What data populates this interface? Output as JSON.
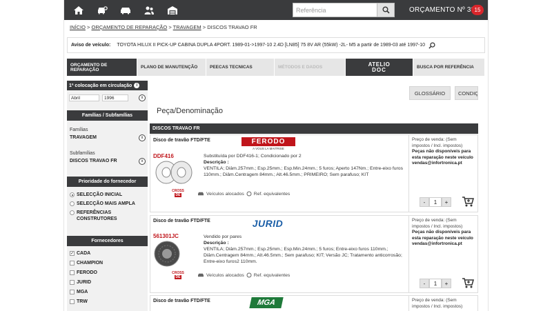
{
  "header": {
    "search_placeholder": "Referência",
    "orcamento_label": "ORÇAMENTO Nº",
    "orcamento_num": "38",
    "badge": "15",
    "nav_icons": [
      "home-icon",
      "car-search-icon",
      "car-icon",
      "users-icon",
      "garage-icon"
    ]
  },
  "breadcrumb": {
    "items": [
      "INÍCIO",
      "ORÇAMENTO DE REPARAÇÃO",
      "TRAVAGEM",
      "DISCOS TRAVAO FR"
    ],
    "sep": " > "
  },
  "vehicle": {
    "label": "Aviso de veículo:",
    "value": "TOYOTA HILUX II PICK-UP CABINA DUPLA 4PORT. 1989-01->1997-10 2.4D [LN85] 75 8V AR (55kW) -2L- M5 a partir de 1989-03 até 1997-10"
  },
  "tabs": [
    {
      "label": "ORÇAMENTO DE REPARAÇÃO"
    },
    {
      "label": "PLANO DE MANUTENÇÃO"
    },
    {
      "label": "PEECAS TECNICAS"
    },
    {
      "label": "MÉTODOS E DADOS"
    },
    {
      "label": "ATELIO"
    },
    {
      "label": "BUSCA POR REFERÊNCIA"
    }
  ],
  "atelio_sub": "DOC",
  "sidebar": {
    "circulation_title": "1ª colocação em circulação",
    "month": "Abril",
    "year": "1996",
    "families_title": "Famílias / Subfamílias",
    "families_label": "Famílias",
    "families_value": "TRAVAGEM",
    "subfamilies_label": "Subfamílias",
    "subfamilies_value": "DISCOS TRAVAO FR",
    "priority_title": "Prioridade do fornecedor",
    "priority_options": [
      "SELECÇÃO INICIAL",
      "SELECÇÃO MAIS AMPLA",
      "REFERÊNCIAS",
      "CONSTRUTORES"
    ],
    "suppliers_title": "Fornecedores",
    "suppliers": [
      "CADA",
      "CHAMPION",
      "FERODO",
      "JURID",
      "MGA",
      "TRW"
    ]
  },
  "main": {
    "glossary": "GLOSSÁRIO",
    "conditions": "CONDIÇÕES DE COMPRA",
    "page_title": "Peça/Denominação",
    "section": "DISCOS TRAVAO FR"
  },
  "products": [
    {
      "type": "Disco de travão FTD/FTE",
      "brand": "FERODO",
      "brand_tagline": "A VOUS LA MAITRISE",
      "ref": "DDF416",
      "subst": "Substituída por DDF416-1; Condicionado por 2",
      "desc_label": "Descrição :",
      "desc": "VENTILA; Diâm.257mm.; Esp.25mm.; Esp.Min.24mm.; 5 furos; Aperto 147Nm.; Entre-eixo furos 110mm.; Diâm.Centragem 84mm.; Alt.46.5mm.; PRIMEIRO; Sem parafuso; KIT"
    },
    {
      "type": "Disco de travão FTD/FTE",
      "brand": "JURID",
      "ref": "561301JC",
      "subst": "Vendido por pares",
      "desc_label": "Descrição :",
      "desc": "VENTILA; Diâm.257mm.; Esp.25mm.; Esp.Min.24mm.; 5 furos; Entre-eixo furos 110mm.; Diâm.Centragem 84mm.; Alt.46.5mm.; Sem parafuso; KIT; Versão JC; Tratamento anticorrosão; Entre-eixo furos2 110mm."
    },
    {
      "type": "Disco de travão FTD/FTE",
      "brand": "MGA"
    }
  ],
  "product_common": {
    "vehicles": "Veículos alocados",
    "equivalents": "Ref. equivalentes",
    "cross_top": "CROSS",
    "cross_bottom": "DE",
    "price_label": "Preço de venda: (Sem impostos / Incl. impostos)",
    "unavailable": "Peças não disponíveis para esta reparação neste veículo",
    "email": "vendas@infortronica.pt",
    "qty": "1",
    "minus": "-",
    "plus": "+"
  },
  "colors": {
    "dark": "#3a3b3d",
    "red": "#c0151b",
    "badge": "#d9262b"
  }
}
